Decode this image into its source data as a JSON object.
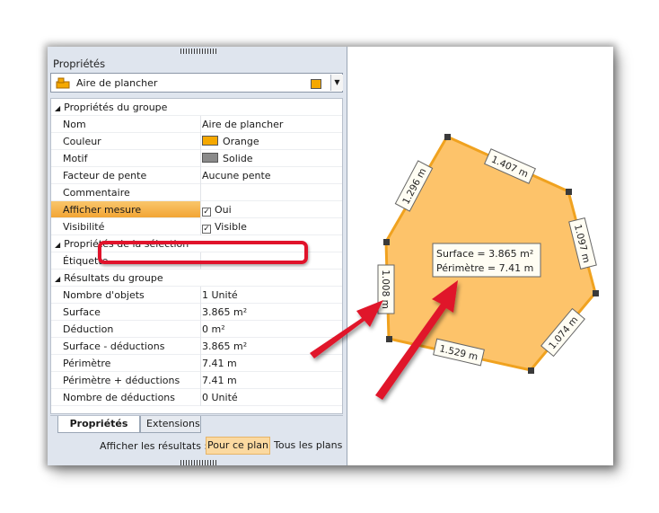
{
  "panel": {
    "title": "Propriétés",
    "combo_label": "Aire de plancher",
    "rows": [
      {
        "type": "category",
        "key": "Propriétés du groupe"
      },
      {
        "type": "prop",
        "key": "Nom",
        "value": "Aire de plancher"
      },
      {
        "type": "prop",
        "key": "Couleur",
        "value": "Orange",
        "swatch": "#f5a800"
      },
      {
        "type": "prop",
        "key": "Motif",
        "value": "Solide",
        "swatch": "#8a8a8a"
      },
      {
        "type": "prop",
        "key": "Facteur de pente",
        "value": "Aucune pente"
      },
      {
        "type": "prop",
        "key": "Commentaire",
        "value": ""
      },
      {
        "type": "prop",
        "key": "Afficher mesure",
        "value": "Oui",
        "checkbox": true,
        "highlight": true
      },
      {
        "type": "prop",
        "key": "Visibilité",
        "value": "Visible",
        "checkbox": true
      },
      {
        "type": "category",
        "key": "Propriétés de la sélection"
      },
      {
        "type": "prop",
        "key": "Étiquette",
        "value": ""
      },
      {
        "type": "category",
        "key": "Résultats du groupe"
      },
      {
        "type": "prop",
        "key": "Nombre d'objets",
        "value": "1 Unité"
      },
      {
        "type": "prop",
        "key": "Surface",
        "value": "3.865 m²"
      },
      {
        "type": "prop",
        "key": "Déduction",
        "value": "0 m²"
      },
      {
        "type": "prop",
        "key": "Surface - déductions",
        "value": "3.865 m²"
      },
      {
        "type": "prop",
        "key": "Périmètre",
        "value": "7.41 m"
      },
      {
        "type": "prop",
        "key": "Périmètre + déductions",
        "value": "7.41 m"
      },
      {
        "type": "prop",
        "key": "Nombre de déductions",
        "value": "0 Unité"
      }
    ],
    "tabs": [
      "Propriétés",
      "Extensions"
    ],
    "results_label": "Afficher les résultats :",
    "btn_plan": "Pour ce plan",
    "btn_all": "Tous les plans"
  },
  "canvas": {
    "fill_color": "#fdc36a",
    "edge_color": "#f0a21f",
    "labels": [
      "1.407 m",
      "1.296 m",
      "1.097 m",
      "1.008 m",
      "1.074 m",
      "1.529 m"
    ],
    "info_surface": "Surface = 3.865 m²",
    "info_perimetre": "Périmètre = 7.41 m"
  },
  "accent": "#e0132b"
}
